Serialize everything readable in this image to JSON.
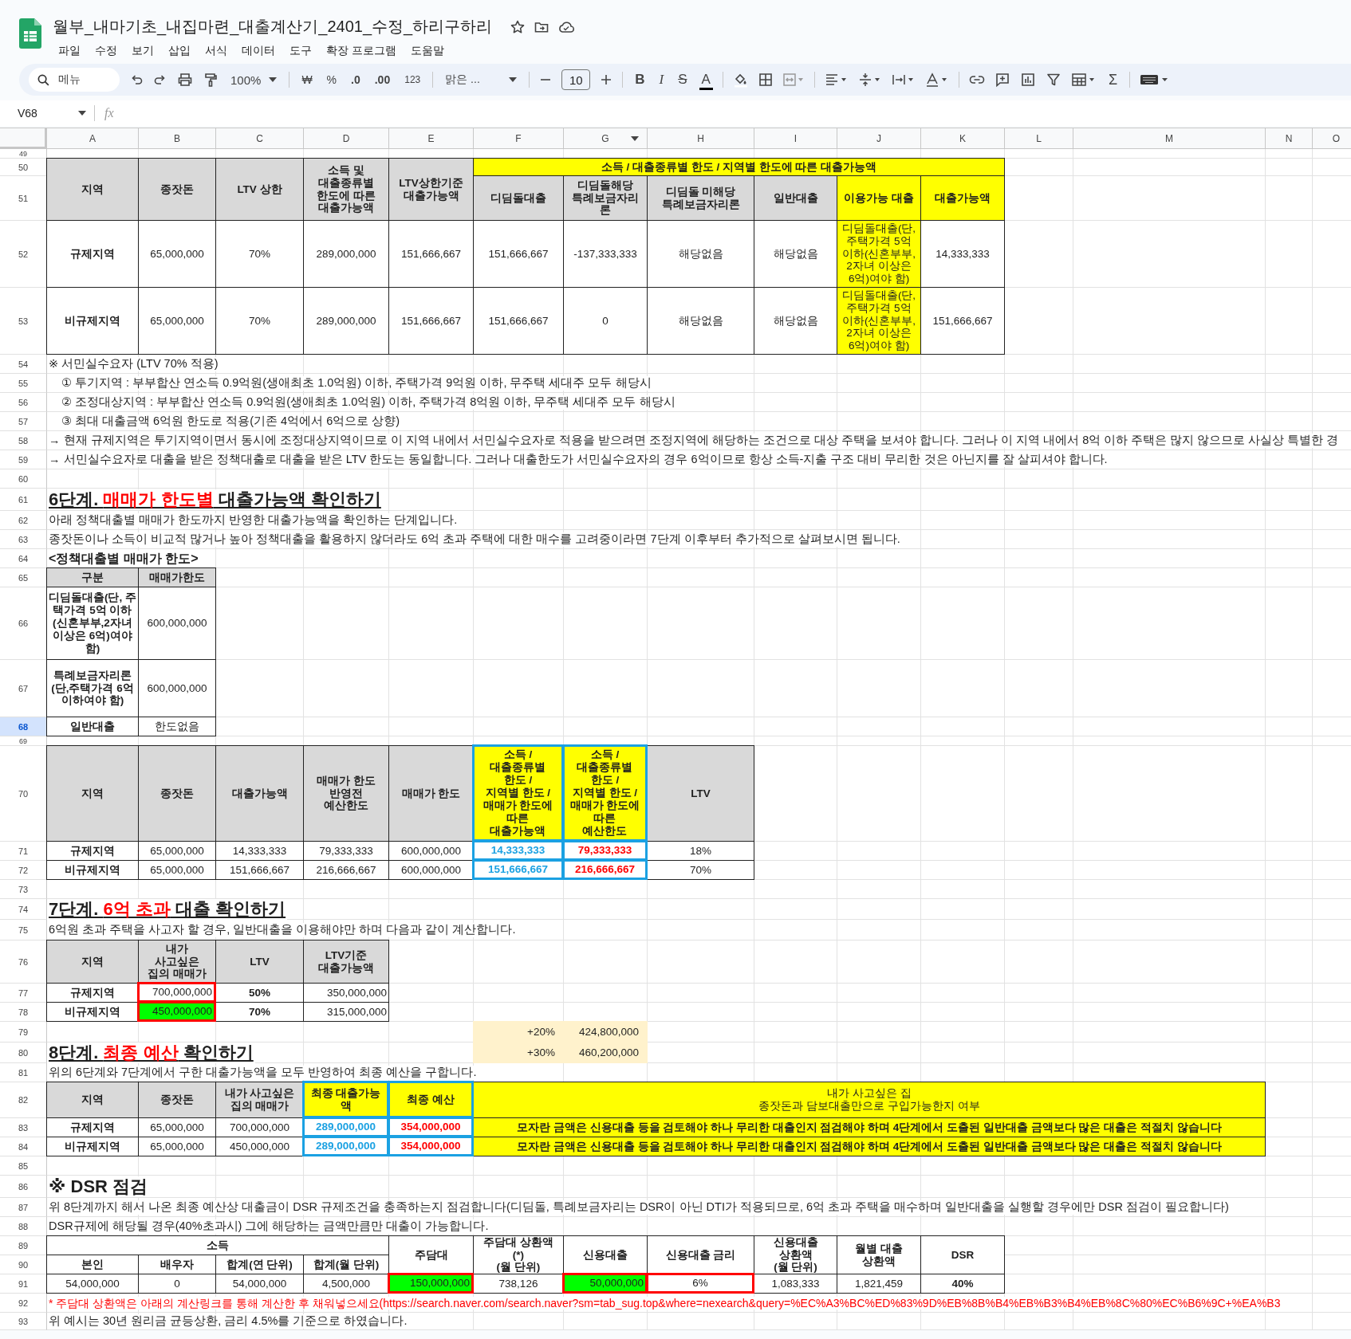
{
  "app": {
    "title": "월부_내마기초_내집마련_대출계산기_2401_수정_하리구하리",
    "menu": [
      "파일",
      "수정",
      "보기",
      "삽입",
      "서식",
      "데이터",
      "도구",
      "확장 프로그램",
      "도움말"
    ]
  },
  "toolbar": {
    "search_placeholder": "메뉴",
    "zoom": "100%",
    "currency": "₩",
    "percent": "%",
    "decrease_decimals": ".0",
    "increase_decimals": ".00",
    "number_format": "123",
    "font": "맑은 ...",
    "font_size": "10",
    "bold": "B",
    "italic": "I",
    "strikethrough": "S",
    "text_color": "A",
    "sum": "Σ"
  },
  "formula_bar": {
    "cell_ref": "V68",
    "function_label": "fx"
  },
  "sheet": {
    "columns": [
      {
        "letter": "A",
        "filtered": false
      },
      {
        "letter": "B",
        "filtered": false
      },
      {
        "letter": "C",
        "filtered": false
      },
      {
        "letter": "D",
        "filtered": false
      },
      {
        "letter": "E",
        "filtered": false
      },
      {
        "letter": "F",
        "filtered": false
      },
      {
        "letter": "G",
        "filtered": true
      },
      {
        "letter": "H",
        "filtered": false
      },
      {
        "letter": "I",
        "filtered": false
      },
      {
        "letter": "J",
        "filtered": false
      },
      {
        "letter": "K",
        "filtered": false
      },
      {
        "letter": "L",
        "filtered": false
      },
      {
        "letter": "M",
        "filtered": false
      },
      {
        "letter": "N",
        "filtered": false
      },
      {
        "letter": "O",
        "filtered": false
      }
    ],
    "rows": [
      {
        "number": "49",
        "kind": "short",
        "selected": false
      },
      {
        "number": "50",
        "kind": "regular",
        "selected": false,
        "cells": [
          {
            "kind": "header",
            "text": "지역"
          },
          {
            "kind": "header",
            "text": "종잣돈"
          },
          {
            "kind": "header",
            "text": "LTV 상한"
          },
          {
            "kind": "header",
            "text": "소득 및\n대출종류별\n한도에 따른\n대출가능액"
          },
          {
            "kind": "header",
            "text": "LTV상한기준\n대출가능액"
          },
          {
            "kind": "header-yellow",
            "text": "소득 / 대출종류별 한도 / 지역별 한도에 따른 대출가능액"
          }
        ]
      },
      {
        "number": "51",
        "kind": "regular",
        "selected": false,
        "cells": [
          {
            "kind": "header",
            "text": "디딤돌대출"
          },
          {
            "kind": "header",
            "text": "디딤돌해당\n특례보금자리\n론"
          },
          {
            "kind": "header",
            "text": "디딤돌 미해당\n특례보금자리론"
          },
          {
            "kind": "header",
            "text": "일반대출"
          },
          {
            "kind": "header-yellow",
            "text": "이용가능 대출"
          },
          {
            "kind": "header-yellow",
            "text": "대출가능액"
          }
        ]
      },
      {
        "number": "52",
        "kind": "regular",
        "selected": false,
        "cells": [
          {
            "kind": "strong",
            "text": "규제지역"
          },
          {
            "kind": "value",
            "text": "65,000,000"
          },
          {
            "kind": "value",
            "text": "70%"
          },
          {
            "kind": "value",
            "text": "289,000,000"
          },
          {
            "kind": "value",
            "text": "151,666,667"
          },
          {
            "kind": "value",
            "text": "151,666,667"
          },
          {
            "kind": "value",
            "text": "-137,333,333"
          },
          {
            "kind": "value",
            "text": "해당없음"
          },
          {
            "kind": "value",
            "text": "해당없음"
          },
          {
            "kind": "yellow",
            "text": "디딤돌대출(단, 주택가격 5억 이하(신혼부부, 2자녀 이상은 6억)여야 함)"
          },
          {
            "kind": "value",
            "text": "14,333,333"
          }
        ]
      },
      {
        "number": "53",
        "kind": "regular",
        "selected": false,
        "cells": [
          {
            "kind": "strong",
            "text": "비규제지역"
          },
          {
            "kind": "value",
            "text": "65,000,000"
          },
          {
            "kind": "value",
            "text": "70%"
          },
          {
            "kind": "value",
            "text": "289,000,000"
          },
          {
            "kind": "value",
            "text": "151,666,667"
          },
          {
            "kind": "value",
            "text": "151,666,667"
          },
          {
            "kind": "value",
            "text": "0"
          },
          {
            "kind": "value",
            "text": "해당없음"
          },
          {
            "kind": "value",
            "text": "해당없음"
          },
          {
            "kind": "yellow",
            "text": "디딤돌대출(단, 주택가격 5억 이하(신혼부부, 2자녀 이상은 6억)여야 함)"
          },
          {
            "kind": "value",
            "text": "151,666,667"
          }
        ]
      },
      {
        "number": "54",
        "kind": "regular",
        "selected": false,
        "cells": [
          {
            "kind": "text",
            "text": "※ 서민실수요자 (LTV 70% 적용)"
          }
        ]
      },
      {
        "number": "55",
        "kind": "regular",
        "selected": false,
        "cells": [
          {
            "kind": "indent-text",
            "text": "① 투기지역 : 부부합산 연소득 0.9억원(생애최초 1.0억원) 이하, 주택가격 9억원 이하, 무주택 세대주 모두 해당시"
          }
        ]
      },
      {
        "number": "56",
        "kind": "regular",
        "selected": false,
        "cells": [
          {
            "kind": "indent-text",
            "text": "② 조정대상지역 : 부부합산 연소득 0.9억원(생애최초 1.0억원) 이하, 주택가격 8억원 이하, 무주택 세대주 모두 해당시"
          }
        ]
      },
      {
        "number": "57",
        "kind": "regular",
        "selected": false,
        "cells": [
          {
            "kind": "indent-text",
            "text": "③ 최대 대출금액 6억원 한도로 적용(기존 4억에서 6억으로 상향)"
          }
        ]
      },
      {
        "number": "58",
        "kind": "regular",
        "selected": false,
        "cells": [
          {
            "kind": "text",
            "text": "→ 현재 규제지역은 투기지역이면서 동시에 조정대상지역이므로 이 지역 내에서 서민실수요자로 적용을 받으려면 조정지역에 해당하는 조건으로 대상 주택을 보셔야 합니다. 그러나 이 지역 내에서 8억 이하 주택은 많지 않으므로 사실상 특별한 경"
          }
        ]
      },
      {
        "number": "59",
        "kind": "regular",
        "selected": false,
        "cells": [
          {
            "kind": "text",
            "text": "→ 서민실수요자로 대출을 받은 정책대출로 대출을 받은 LTV 한도는 동일합니다. 그러나 대출한도가 서민실수요자의 경우 6억이므로 항상 소득-지출 구조 대비 무리한 것은 아닌지를 잘 살피셔야 합니다."
          }
        ]
      },
      {
        "number": "60",
        "kind": "regular",
        "selected": false
      },
      {
        "number": "61",
        "kind": "regular",
        "selected": false,
        "cells": [
          {
            "kind": "heading",
            "parts": [
              {
                "text": "6단계. ",
                "accent": false
              },
              {
                "text": "매매가 한도별",
                "accent": true
              },
              {
                "text": " 대출가능액 확인하기",
                "accent": false
              }
            ]
          }
        ]
      },
      {
        "number": "62",
        "kind": "regular",
        "selected": false,
        "cells": [
          {
            "kind": "text",
            "text": "아래 정책대출별 매매가 한도까지 반영한 대출가능액을 확인하는 단계입니다."
          }
        ]
      },
      {
        "number": "63",
        "kind": "regular",
        "selected": false,
        "cells": [
          {
            "kind": "text",
            "text": "종잣돈이나 소득이 비교적 많거나 높아 정책대출을 활용하지 않더라도 6억 초과 주택에 대한 매수를 고려중이라면 7단계 이후부터 추가적으로 살펴보시면 됩니다."
          }
        ]
      },
      {
        "number": "64",
        "kind": "regular",
        "selected": false,
        "cells": [
          {
            "kind": "subheading",
            "text": "<정책대출별 매매가 한도>"
          }
        ]
      },
      {
        "number": "65",
        "kind": "regular",
        "selected": false,
        "cells": [
          {
            "kind": "header",
            "text": "구분"
          },
          {
            "kind": "header",
            "text": "매매가한도"
          }
        ]
      },
      {
        "number": "66",
        "kind": "regular",
        "selected": false,
        "cells": [
          {
            "kind": "strong",
            "text": "디딤돌대출(단, 주택가격 5억 이하(신혼부부,2자녀 이상은 6억)여야 함)"
          },
          {
            "kind": "value",
            "text": "600,000,000"
          }
        ]
      },
      {
        "number": "67",
        "kind": "regular",
        "selected": false,
        "cells": [
          {
            "kind": "strong",
            "text": "특례보금자리론(단,주택가격 6억 이하여야 함)"
          },
          {
            "kind": "value",
            "text": "600,000,000"
          }
        ]
      },
      {
        "number": "68",
        "kind": "regular",
        "selected": true,
        "cells": [
          {
            "kind": "strong",
            "text": "일반대출"
          },
          {
            "kind": "value",
            "text": "한도없음"
          }
        ]
      },
      {
        "number": "69",
        "kind": "short",
        "selected": false
      },
      {
        "number": "70",
        "kind": "regular",
        "selected": false,
        "cells": [
          {
            "kind": "header",
            "text": "지역"
          },
          {
            "kind": "header",
            "text": "종잣돈"
          },
          {
            "kind": "header",
            "text": "대출가능액"
          },
          {
            "kind": "header",
            "text": "매매가 한도\n반영전\n예산한도"
          },
          {
            "kind": "header",
            "text": "매매가 한도"
          },
          {
            "kind": "header-result",
            "text": "소득 /\n대출종류별\n한도 /\n지역별 한도 /\n매매가 한도에\n따른\n대출가능액"
          },
          {
            "kind": "header-result",
            "text": "소득 /\n대출종류별\n한도 /\n지역별 한도 /\n매매가 한도에\n따른\n예산한도"
          },
          {
            "kind": "header",
            "text": "LTV"
          }
        ]
      },
      {
        "number": "71",
        "kind": "regular",
        "selected": false,
        "cells": [
          {
            "kind": "strong",
            "text": "규제지역"
          },
          {
            "kind": "value",
            "text": "65,000,000"
          },
          {
            "kind": "value",
            "text": "14,333,333"
          },
          {
            "kind": "value",
            "text": "79,333,333"
          },
          {
            "kind": "value",
            "text": "600,000,000"
          },
          {
            "kind": "result-loan",
            "text": "14,333,333"
          },
          {
            "kind": "result-budget",
            "text": "79,333,333"
          },
          {
            "kind": "value",
            "text": "18%"
          }
        ]
      },
      {
        "number": "72",
        "kind": "regular",
        "selected": false,
        "cells": [
          {
            "kind": "strong",
            "text": "비규제지역"
          },
          {
            "kind": "value",
            "text": "65,000,000"
          },
          {
            "kind": "value",
            "text": "151,666,667"
          },
          {
            "kind": "value",
            "text": "216,666,667"
          },
          {
            "kind": "value",
            "text": "600,000,000"
          },
          {
            "kind": "result-loan",
            "text": "151,666,667"
          },
          {
            "kind": "result-budget",
            "text": "216,666,667"
          },
          {
            "kind": "value",
            "text": "70%"
          }
        ]
      },
      {
        "number": "73",
        "kind": "regular",
        "selected": false
      },
      {
        "number": "74",
        "kind": "regular",
        "selected": false,
        "cells": [
          {
            "kind": "heading",
            "parts": [
              {
                "text": "7단계. ",
                "accent": false
              },
              {
                "text": "6억 초과",
                "accent": true
              },
              {
                "text": " 대출 확인하기",
                "accent": false
              }
            ]
          }
        ]
      },
      {
        "number": "75",
        "kind": "regular",
        "selected": false,
        "cells": [
          {
            "kind": "text",
            "text": "6억원 초과 주택을 사고자 할 경우, 일반대출을 이용해야만 하며 다음과 같이 계산합니다."
          }
        ]
      },
      {
        "number": "76",
        "kind": "regular",
        "selected": false,
        "cells": [
          {
            "kind": "header",
            "text": "지역"
          },
          {
            "kind": "header",
            "text": "내가\n사고싶은\n집의 매매가"
          },
          {
            "kind": "header",
            "text": "LTV"
          },
          {
            "kind": "header",
            "text": "LTV기준\n대출가능액"
          }
        ]
      },
      {
        "number": "77",
        "kind": "regular",
        "selected": false,
        "cells": [
          {
            "kind": "strong",
            "text": "규제지역"
          },
          {
            "kind": "entry",
            "text": "700,000,000"
          },
          {
            "kind": "strong",
            "text": "50%"
          },
          {
            "kind": "number",
            "text": "350,000,000"
          }
        ]
      },
      {
        "number": "78",
        "kind": "regular",
        "selected": false,
        "cells": [
          {
            "kind": "strong",
            "text": "비규제지역"
          },
          {
            "kind": "input",
            "text": "450,000,000"
          },
          {
            "kind": "strong",
            "text": "70%"
          },
          {
            "kind": "number",
            "text": "315,000,000"
          }
        ]
      },
      {
        "number": "79",
        "kind": "regular",
        "selected": false,
        "cells": [
          {
            "kind": "beige",
            "text": "+20%"
          },
          {
            "kind": "beige",
            "text": "424,800,000"
          }
        ]
      },
      {
        "number": "80",
        "kind": "regular",
        "selected": false,
        "cells": [
          {
            "kind": "heading",
            "parts": [
              {
                "text": "8단계. ",
                "accent": false
              },
              {
                "text": "최종 예산",
                "accent": true
              },
              {
                "text": " 확인하기",
                "accent": false
              }
            ]
          },
          {
            "kind": "beige",
            "text": "+30%"
          },
          {
            "kind": "beige",
            "text": "460,200,000"
          }
        ]
      },
      {
        "number": "81",
        "kind": "regular",
        "selected": false,
        "cells": [
          {
            "kind": "text",
            "text": "위의 6단계와 7단계에서 구한 대출가능액을 모두 반영하여 최종 예산을 구합니다."
          }
        ]
      },
      {
        "number": "82",
        "kind": "regular",
        "selected": false,
        "cells": [
          {
            "kind": "header",
            "text": "지역"
          },
          {
            "kind": "header",
            "text": "종잣돈"
          },
          {
            "kind": "header",
            "text": "내가 사고싶은\n집의 매매가"
          },
          {
            "kind": "header-result",
            "text": "최종 대출가능액"
          },
          {
            "kind": "header-result",
            "text": "최종 예산"
          },
          {
            "kind": "yellow",
            "text": "내가 사고싶은 집\n종잣돈과 담보대출만으로 구입가능한지 여부"
          }
        ]
      },
      {
        "number": "83",
        "kind": "regular",
        "selected": false,
        "cells": [
          {
            "kind": "strong",
            "text": "규제지역"
          },
          {
            "kind": "value",
            "text": "65,000,000"
          },
          {
            "kind": "value",
            "text": "700,000,000"
          },
          {
            "kind": "result-loan",
            "text": "289,000,000"
          },
          {
            "kind": "result-budget",
            "text": "354,000,000"
          },
          {
            "kind": "yellow-strong",
            "text": "모자란 금액은 신용대출 등을 검토해야 하나 무리한 대출인지 점검해야 하며 4단계에서 도출된 일반대출 금액보다 많은 대출은 적절치 않습니다"
          }
        ]
      },
      {
        "number": "84",
        "kind": "regular",
        "selected": false,
        "cells": [
          {
            "kind": "strong",
            "text": "비규제지역"
          },
          {
            "kind": "value",
            "text": "65,000,000"
          },
          {
            "kind": "value",
            "text": "450,000,000"
          },
          {
            "kind": "result-loan",
            "text": "289,000,000"
          },
          {
            "kind": "result-budget",
            "text": "354,000,000"
          },
          {
            "kind": "yellow-strong",
            "text": "모자란 금액은 신용대출 등을 검토해야 하나 무리한 대출인지 점검해야 하며 4단계에서 도출된 일반대출 금액보다 많은 대출은 적절치 않습니다"
          }
        ]
      },
      {
        "number": "85",
        "kind": "regular",
        "selected": false
      },
      {
        "number": "86",
        "kind": "regular",
        "selected": false,
        "cells": [
          {
            "kind": "heading-plain",
            "text": "※ DSR 점검"
          }
        ]
      },
      {
        "number": "87",
        "kind": "regular",
        "selected": false,
        "cells": [
          {
            "kind": "text",
            "text": "위 8단계까지 해서 나온 최종 예산상 대출금이 DSR 규제조건을 충족하는지 점검합니다(디딤돌, 특례보금자리는 DSR이 아닌 DTI가 적용되므로, 6억 초과 주택을 매수하며 일반대출을 실행할 경우에만 DSR 점검이 필요합니다)"
          }
        ]
      },
      {
        "number": "88",
        "kind": "regular",
        "selected": false,
        "cells": [
          {
            "kind": "text",
            "text": "DSR규제에 해당될 경우(40%초과시) 그에 해당하는 금액만큼만 대출이 가능합니다."
          }
        ]
      },
      {
        "number": "89",
        "kind": "regular",
        "selected": false,
        "cells": [
          {
            "kind": "header-plain",
            "text": "소득"
          },
          {
            "kind": "header-plain",
            "text": "주담대"
          },
          {
            "kind": "header-plain",
            "text": "주담대 상환액\n(*)\n(월 단위)"
          },
          {
            "kind": "header-plain",
            "text": "신용대출"
          },
          {
            "kind": "header-plain",
            "text": "신용대출 금리"
          },
          {
            "kind": "header-plain",
            "text": "신용대출\n상환액\n(월 단위)"
          },
          {
            "kind": "header-plain",
            "text": "월별 대출\n상환액"
          },
          {
            "kind": "header-plain",
            "text": "DSR"
          }
        ]
      },
      {
        "number": "90",
        "kind": "regular",
        "selected": false,
        "cells": [
          {
            "kind": "header-plain",
            "text": "본인"
          },
          {
            "kind": "header-plain",
            "text": "배우자"
          },
          {
            "kind": "header-plain",
            "text": "합계(연 단위)"
          },
          {
            "kind": "header-plain",
            "text": "합계(월 단위)"
          }
        ]
      },
      {
        "number": "91",
        "kind": "regular",
        "selected": false,
        "cells": [
          {
            "kind": "value",
            "text": "54,000,000"
          },
          {
            "kind": "value",
            "text": "0"
          },
          {
            "kind": "value",
            "text": "54,000,000"
          },
          {
            "kind": "value",
            "text": "4,500,000"
          },
          {
            "kind": "input",
            "text": "150,000,000"
          },
          {
            "kind": "value",
            "text": "738,126"
          },
          {
            "kind": "input",
            "text": "50,000,000"
          },
          {
            "kind": "rate-entry",
            "text": "6%"
          },
          {
            "kind": "value",
            "text": "1,083,333"
          },
          {
            "kind": "value",
            "text": "1,821,459"
          },
          {
            "kind": "strong",
            "text": "40%"
          }
        ]
      },
      {
        "number": "92",
        "kind": "regular",
        "selected": false,
        "cells": [
          {
            "kind": "note",
            "text": "* 주담대 상환액은 아래의 계산링크를 통해 계산한 후 채워넣으세요(https://search.naver.com/search.naver?sm=tab_sug.top&where=nexearch&query=%EC%A3%BC%ED%83%9D%EB%8B%B4%EB%B3%B4%EB%8C%80%EC%B6%9C+%EA%B3"
          }
        ]
      },
      {
        "number": "93",
        "kind": "regular",
        "selected": false,
        "cells": [
          {
            "kind": "text",
            "text": "위 예시는 30년 원리금 균등상환, 금리 4.5%를 기준으로 하였습니다."
          }
        ]
      }
    ]
  }
}
